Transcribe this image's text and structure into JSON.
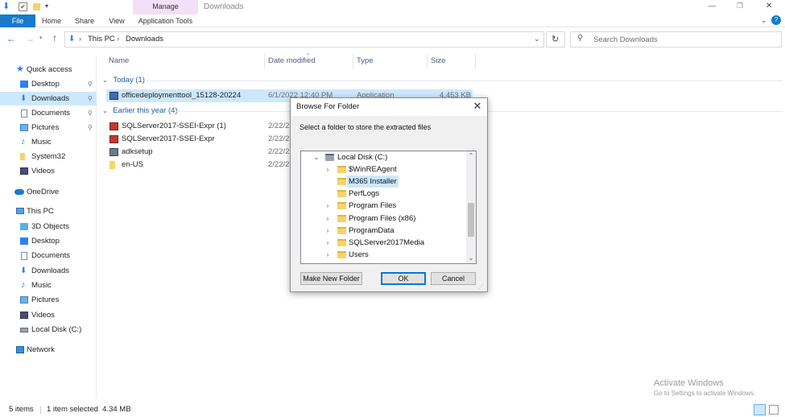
{
  "titlebar": {
    "title": "Downloads",
    "contextual_tab": "Manage",
    "controls": {
      "minimize": "—",
      "maximize": "❐",
      "close": "✕"
    }
  },
  "ribbon": {
    "tabs": [
      "File",
      "Home",
      "Share",
      "View",
      "Application Tools"
    ],
    "help": "?"
  },
  "address": {
    "crumbs": [
      "This PC",
      "Downloads"
    ],
    "search_placeholder": "Search Downloads"
  },
  "nav": {
    "quick_access": "Quick access",
    "quick_items": [
      {
        "label": "Desktop",
        "icon": "desktop-icon",
        "pinned": true
      },
      {
        "label": "Downloads",
        "icon": "download-arrow-icon",
        "pinned": true,
        "selected": true
      },
      {
        "label": "Documents",
        "icon": "documents-icon",
        "pinned": true
      },
      {
        "label": "Pictures",
        "icon": "pictures-icon",
        "pinned": true
      },
      {
        "label": "Music",
        "icon": "music-icon",
        "pinned": false
      },
      {
        "label": "System32",
        "icon": "folder-icon",
        "pinned": false
      },
      {
        "label": "Videos",
        "icon": "videos-icon",
        "pinned": false
      }
    ],
    "onedrive": "OneDrive",
    "this_pc": "This PC",
    "pc_items": [
      {
        "label": "3D Objects",
        "icon": "3d-objects-icon"
      },
      {
        "label": "Desktop",
        "icon": "desktop-icon"
      },
      {
        "label": "Documents",
        "icon": "documents-icon"
      },
      {
        "label": "Downloads",
        "icon": "download-arrow-icon"
      },
      {
        "label": "Music",
        "icon": "music-icon"
      },
      {
        "label": "Pictures",
        "icon": "pictures-icon"
      },
      {
        "label": "Videos",
        "icon": "videos-icon"
      },
      {
        "label": "Local Disk (C:)",
        "icon": "drive-icon"
      }
    ],
    "network": "Network",
    "pin_glyph": "📌"
  },
  "files": {
    "columns": [
      "Name",
      "Date modified",
      "Type",
      "Size"
    ],
    "groups": [
      {
        "header": "Today (1)",
        "rows": [
          {
            "name": "officedeploymenttool_15128-20224",
            "date": "6/1/2022 12:40 PM",
            "type": "Application",
            "size": "4,453 KB",
            "selected": true
          }
        ]
      },
      {
        "header": "Earlier this year (4)",
        "rows": [
          {
            "name": "SQLServer2017-SSEI-Expr (1)",
            "date": "2/22/2",
            "type": "",
            "size": ""
          },
          {
            "name": "SQLServer2017-SSEI-Expr",
            "date": "2/22/2",
            "type": "",
            "size": ""
          },
          {
            "name": "adksetup",
            "date": "2/22/2",
            "type": "",
            "size": ""
          },
          {
            "name": "en-US",
            "date": "2/22/2",
            "type": "",
            "size": ""
          }
        ]
      }
    ]
  },
  "status": {
    "count": "5 items",
    "selection": "1 item selected  4.34 MB"
  },
  "watermark": {
    "line1": "Activate Windows",
    "line2": "Go to Settings to activate Windows."
  },
  "dialog": {
    "title": "Browse For Folder",
    "prompt": "Select a folder to store the extracted files",
    "tree": [
      {
        "label": "Local Disk (C:)",
        "level": 0,
        "expanded": true,
        "drive": true
      },
      {
        "label": "$WinREAgent",
        "level": 1,
        "has_children": true
      },
      {
        "label": "M365 Installer",
        "level": 1,
        "has_children": false,
        "selected": true
      },
      {
        "label": "PerfLogs",
        "level": 1,
        "has_children": false
      },
      {
        "label": "Program Files",
        "level": 1,
        "has_children": true
      },
      {
        "label": "Program Files (x86)",
        "level": 1,
        "has_children": true
      },
      {
        "label": "ProgramData",
        "level": 1,
        "has_children": true
      },
      {
        "label": "SQLServer2017Media",
        "level": 1,
        "has_children": true
      },
      {
        "label": "Users",
        "level": 1,
        "has_children": true
      }
    ],
    "buttons": {
      "new_folder": "Make New Folder",
      "ok": "OK",
      "cancel": "Cancel"
    }
  },
  "colors": {
    "accent": "#1979ca",
    "selection": "#cce8ff",
    "manage_band": "#f3dff7"
  }
}
